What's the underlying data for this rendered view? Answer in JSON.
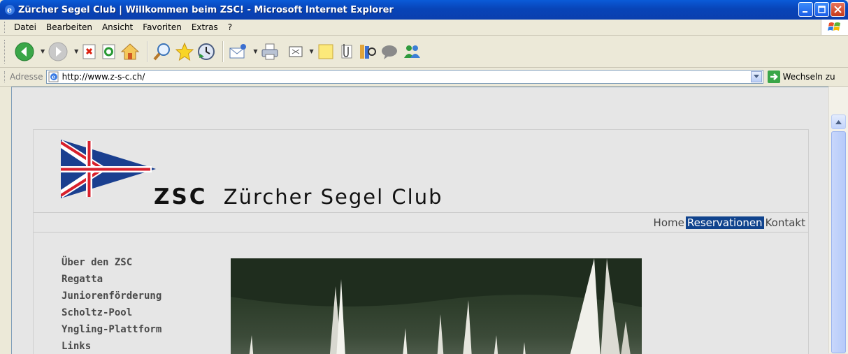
{
  "window": {
    "title": "Zürcher Segel Club | Willkommen beim ZSC! - Microsoft Internet Explorer"
  },
  "menu": {
    "items": [
      "Datei",
      "Bearbeiten",
      "Ansicht",
      "Favoriten",
      "Extras",
      "?"
    ]
  },
  "address": {
    "label": "Adresse",
    "url": "http://www.z-s-c.ch/",
    "go_label": "Wechseln zu"
  },
  "site": {
    "logo_abbr": "ZSC",
    "logo_name": "Zürcher Segel Club",
    "topnav": [
      "Home",
      "Reservationen",
      "Kontakt"
    ],
    "topnav_active": "Reservationen",
    "sidenav": [
      "Über den ZSC",
      "Regatta",
      "Juniorenförderung",
      "Scholtz-Pool",
      "Yngling-Plattform",
      "Links"
    ]
  },
  "colors": {
    "xp_title": "#0a5bd8",
    "nav_active": "#10438d",
    "pennant_blue": "#1a3f8f",
    "pennant_red": "#d8202c"
  }
}
